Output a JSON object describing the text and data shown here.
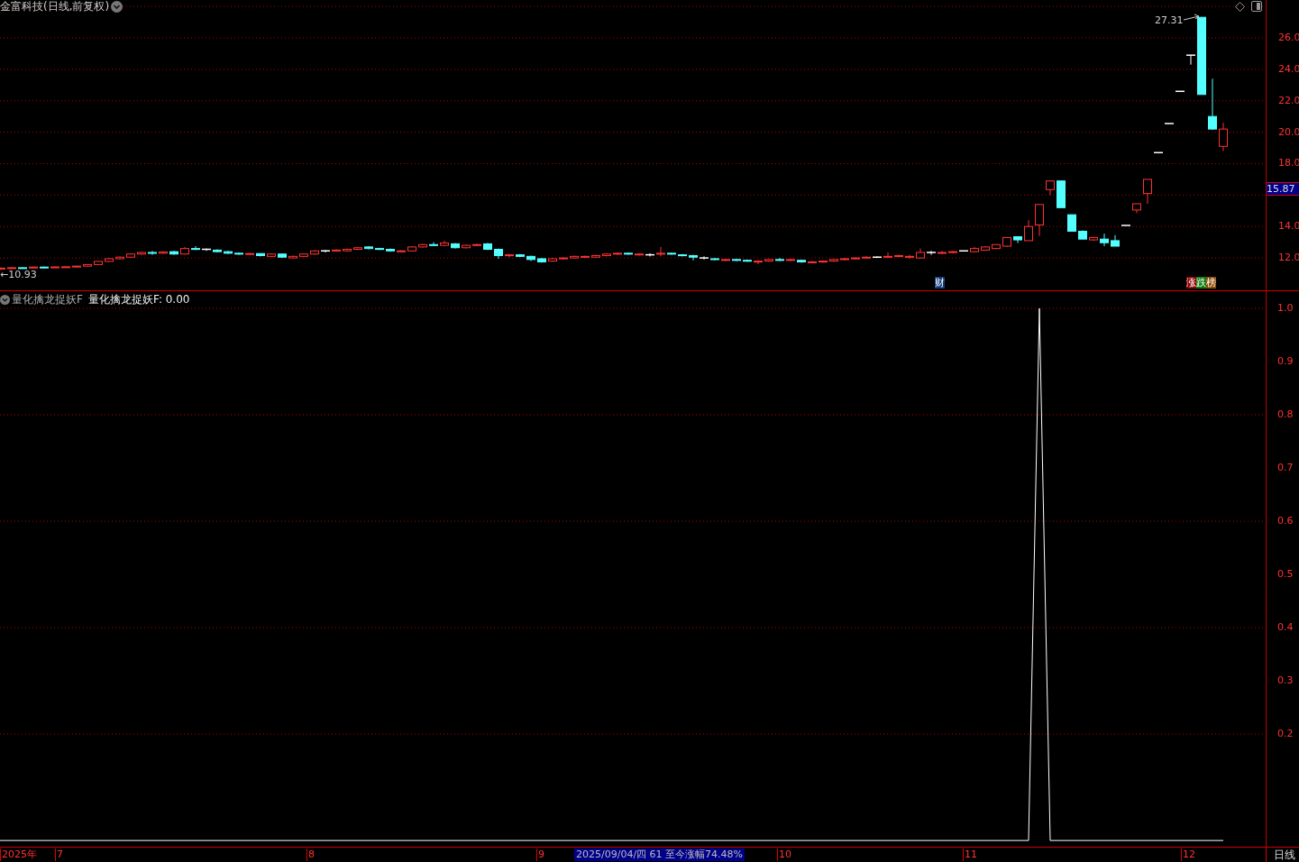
{
  "title": "金富科技(日线,前复权)",
  "price_panel": {
    "high_label": "27.31",
    "low_label": "←10.93",
    "last_price": "15.87",
    "chart_data": {
      "type": "candlestick",
      "ylim": [
        9.94,
        28.41
      ],
      "yticks": [
        {
          "value": 26,
          "label": "26.0"
        },
        {
          "value": 24,
          "label": "24.0"
        },
        {
          "value": 22,
          "label": "22.0"
        },
        {
          "value": 20,
          "label": "20.0"
        },
        {
          "value": 18,
          "label": "18.0"
        },
        {
          "value": 14,
          "label": "14.0"
        },
        {
          "value": 12,
          "label": "12.0"
        }
      ],
      "grid": true,
      "ohlc": [
        [
          11.3,
          11.4,
          11.25,
          11.35
        ],
        [
          11.35,
          11.42,
          11.3,
          11.38
        ],
        [
          11.38,
          11.4,
          11.32,
          11.36
        ],
        [
          11.36,
          11.45,
          11.33,
          11.42
        ],
        [
          11.42,
          11.46,
          11.36,
          11.4
        ],
        [
          11.4,
          11.45,
          11.38,
          11.43
        ],
        [
          11.43,
          11.47,
          11.4,
          11.44
        ],
        [
          11.44,
          11.5,
          11.41,
          11.48
        ],
        [
          11.48,
          11.6,
          11.46,
          11.58
        ],
        [
          11.58,
          11.8,
          11.56,
          11.78
        ],
        [
          11.78,
          12.0,
          11.75,
          11.95
        ],
        [
          11.95,
          12.1,
          11.9,
          12.05
        ],
        [
          12.05,
          12.3,
          12.0,
          12.25
        ],
        [
          12.25,
          12.4,
          12.2,
          12.35
        ],
        [
          12.35,
          12.45,
          12.2,
          12.3
        ],
        [
          12.3,
          12.42,
          12.25,
          12.38
        ],
        [
          12.4,
          12.45,
          12.2,
          12.25
        ],
        [
          12.25,
          12.7,
          12.22,
          12.6
        ],
        [
          12.6,
          12.75,
          12.5,
          12.55
        ],
        [
          12.55,
          12.6,
          12.45,
          12.55
        ],
        [
          12.5,
          12.55,
          12.35,
          12.4
        ],
        [
          12.4,
          12.45,
          12.25,
          12.3
        ],
        [
          12.3,
          12.35,
          12.2,
          12.25
        ],
        [
          12.25,
          12.32,
          12.18,
          12.28
        ],
        [
          12.28,
          12.3,
          12.1,
          12.15
        ],
        [
          12.1,
          12.3,
          12.05,
          12.25
        ],
        [
          12.25,
          12.28,
          12.0,
          12.05
        ],
        [
          12.0,
          12.15,
          11.95,
          12.1
        ],
        [
          12.1,
          12.3,
          12.05,
          12.25
        ],
        [
          12.25,
          12.5,
          12.2,
          12.45
        ],
        [
          12.45,
          12.5,
          12.35,
          12.45
        ],
        [
          12.45,
          12.55,
          12.4,
          12.5
        ],
        [
          12.45,
          12.6,
          12.4,
          12.55
        ],
        [
          12.55,
          12.7,
          12.5,
          12.65
        ],
        [
          12.7,
          12.75,
          12.55,
          12.6
        ],
        [
          12.6,
          12.65,
          12.5,
          12.55
        ],
        [
          12.55,
          12.6,
          12.4,
          12.45
        ],
        [
          12.4,
          12.5,
          12.35,
          12.45
        ],
        [
          12.45,
          12.75,
          12.4,
          12.7
        ],
        [
          12.7,
          12.9,
          12.65,
          12.85
        ],
        [
          12.85,
          13.0,
          12.75,
          12.8
        ],
        [
          12.8,
          13.1,
          12.75,
          12.95
        ],
        [
          12.9,
          12.95,
          12.6,
          12.65
        ],
        [
          12.65,
          12.85,
          12.6,
          12.8
        ],
        [
          12.8,
          12.9,
          12.75,
          12.85
        ],
        [
          12.9,
          12.95,
          12.5,
          12.55
        ],
        [
          12.55,
          12.6,
          11.95,
          12.15
        ],
        [
          12.15,
          12.25,
          12.05,
          12.2
        ],
        [
          12.2,
          12.25,
          12.05,
          12.1
        ],
        [
          12.1,
          12.15,
          11.8,
          11.9
        ],
        [
          11.95,
          12.0,
          11.7,
          11.75
        ],
        [
          11.8,
          12.0,
          11.75,
          11.95
        ],
        [
          11.95,
          12.05,
          11.9,
          12.0
        ],
        [
          12.0,
          12.15,
          11.95,
          12.1
        ],
        [
          12.05,
          12.15,
          12.0,
          12.1
        ],
        [
          12.05,
          12.2,
          12.0,
          12.15
        ],
        [
          12.15,
          12.3,
          12.1,
          12.25
        ],
        [
          12.25,
          12.35,
          12.2,
          12.3
        ],
        [
          12.3,
          12.35,
          12.2,
          12.25
        ],
        [
          12.2,
          12.3,
          12.15,
          12.25
        ],
        [
          12.2,
          12.3,
          12.1,
          12.2
        ],
        [
          12.25,
          12.7,
          12.1,
          12.3
        ],
        [
          12.3,
          12.35,
          12.2,
          12.25
        ],
        [
          12.2,
          12.25,
          12.1,
          12.15
        ],
        [
          12.15,
          12.2,
          11.85,
          12.05
        ],
        [
          12.0,
          12.1,
          11.9,
          12.0
        ],
        [
          11.95,
          12.0,
          11.85,
          11.9
        ],
        [
          11.85,
          11.95,
          11.8,
          11.9
        ],
        [
          11.9,
          11.95,
          11.8,
          11.85
        ],
        [
          11.85,
          11.9,
          11.75,
          11.8
        ],
        [
          11.75,
          11.85,
          11.6,
          11.8
        ],
        [
          11.8,
          11.95,
          11.75,
          11.9
        ],
        [
          11.9,
          12.0,
          11.8,
          11.85
        ],
        [
          11.85,
          11.95,
          11.8,
          11.9
        ],
        [
          11.85,
          11.9,
          11.7,
          11.75
        ],
        [
          11.7,
          11.8,
          11.65,
          11.75
        ],
        [
          11.75,
          11.85,
          11.7,
          11.8
        ],
        [
          11.8,
          11.95,
          11.75,
          11.9
        ],
        [
          11.9,
          12.0,
          11.85,
          11.95
        ],
        [
          11.95,
          12.05,
          11.9,
          12.0
        ],
        [
          12.0,
          12.1,
          11.95,
          12.05
        ],
        [
          12.05,
          12.1,
          12.0,
          12.05
        ],
        [
          12.05,
          12.35,
          12.0,
          12.1
        ],
        [
          12.1,
          12.2,
          12.05,
          12.15
        ],
        [
          12.05,
          12.2,
          11.95,
          12.1
        ],
        [
          12.0,
          12.6,
          11.95,
          12.35
        ],
        [
          12.35,
          12.45,
          12.2,
          12.35
        ],
        [
          12.3,
          12.45,
          12.25,
          12.35
        ],
        [
          12.35,
          12.45,
          12.3,
          12.4
        ],
        [
          12.45,
          12.45,
          12.45,
          12.45
        ],
        [
          12.4,
          12.7,
          12.35,
          12.6
        ],
        [
          12.5,
          12.75,
          12.45,
          12.7
        ],
        [
          12.6,
          12.85,
          12.55,
          12.85
        ],
        [
          12.75,
          13.3,
          12.7,
          13.3
        ],
        [
          13.35,
          13.35,
          12.95,
          13.15
        ],
        [
          13.1,
          14.4,
          13.1,
          14.0
        ],
        [
          14.1,
          15.4,
          13.4,
          15.4
        ],
        [
          16.35,
          16.9,
          16.0,
          16.9
        ],
        [
          16.9,
          16.9,
          15.2,
          15.2
        ],
        [
          14.75,
          14.75,
          13.7,
          13.7
        ],
        [
          13.7,
          13.75,
          13.2,
          13.2
        ],
        [
          13.15,
          13.3,
          13.1,
          13.3
        ],
        [
          13.2,
          13.55,
          12.75,
          12.97
        ],
        [
          13.1,
          13.45,
          12.75,
          12.75
        ],
        [
          14.07,
          14.07,
          14.07,
          14.07
        ],
        [
          15.05,
          15.45,
          14.85,
          15.45
        ],
        [
          16.1,
          17.0,
          15.45,
          17.0
        ],
        [
          18.7,
          18.7,
          18.7,
          18.7
        ],
        [
          20.55,
          20.55,
          20.55,
          20.55
        ],
        [
          22.6,
          22.6,
          22.6,
          22.6
        ],
        [
          24.9,
          24.9,
          24.3,
          24.9
        ],
        [
          27.31,
          27.31,
          22.4,
          22.4
        ],
        [
          21.0,
          23.4,
          20.15,
          20.2
        ],
        [
          19.1,
          20.6,
          18.8,
          20.2
        ]
      ]
    },
    "badges": [
      {
        "kind": "finance",
        "text": "财"
      },
      {
        "kind": "ranking",
        "chars": [
          {
            "text": "涨",
            "color": "#8b0000"
          },
          {
            "text": "跌",
            "color": "#0a7a0a"
          },
          {
            "text": "榜",
            "color": "#8b4a00"
          }
        ]
      }
    ]
  },
  "indicator_panel": {
    "name": "量化擒龙捉妖F",
    "legend": "量化擒龙捉妖F: 0.00",
    "chart_data": {
      "type": "line",
      "ylim": [
        -0.0133,
        1
      ],
      "grid": true,
      "yticks": [
        {
          "value": 1,
          "label": "1.0"
        },
        {
          "value": 0.9,
          "label": "0.9"
        },
        {
          "value": 0.8,
          "label": "0.8"
        },
        {
          "value": 0.7,
          "label": "0.7"
        },
        {
          "value": 0.6,
          "label": "0.6"
        },
        {
          "value": 0.5,
          "label": "0.5"
        },
        {
          "value": 0.4,
          "label": "0.4"
        },
        {
          "value": 0.3,
          "label": "0.3"
        },
        {
          "value": 0.2,
          "label": "0.2"
        }
      ],
      "series": [
        {
          "color": "#ffffff",
          "values": [
            0,
            0,
            0,
            0,
            0,
            0,
            0,
            0,
            0,
            0,
            0,
            0,
            0,
            0,
            0,
            0,
            0,
            0,
            0,
            0,
            0,
            0,
            0,
            0,
            0,
            0,
            0,
            0,
            0,
            0,
            0,
            0,
            0,
            0,
            0,
            0,
            0,
            0,
            0,
            0,
            0,
            0,
            0,
            0,
            0,
            0,
            0,
            0,
            0,
            0,
            0,
            0,
            0,
            0,
            0,
            0,
            0,
            0,
            0,
            0,
            0,
            0,
            0,
            0,
            0,
            0,
            0,
            0,
            0,
            0,
            0,
            0,
            0,
            0,
            0,
            0,
            0,
            0,
            0,
            0,
            0,
            0,
            0,
            0,
            0,
            0,
            0,
            0,
            0,
            0,
            0,
            0,
            0,
            0,
            0,
            0,
            1,
            0,
            0,
            0,
            0,
            0,
            0,
            0,
            0,
            0,
            0,
            0,
            0,
            0,
            0,
            0,
            0,
            0
          ]
        }
      ]
    }
  },
  "time_axis": {
    "labels": [
      {
        "kind": "plain",
        "text": "2025年"
      },
      {
        "kind": "plain",
        "text": "7"
      },
      {
        "kind": "plain",
        "text": "8"
      },
      {
        "kind": "plain",
        "text": "9"
      },
      {
        "kind": "highlight",
        "text": "2025/09/04/四 61 至今涨幅74.48%"
      },
      {
        "kind": "plain",
        "text": "10"
      },
      {
        "kind": "plain",
        "text": "11"
      },
      {
        "kind": "plain",
        "text": "12"
      }
    ],
    "period": "日线"
  }
}
